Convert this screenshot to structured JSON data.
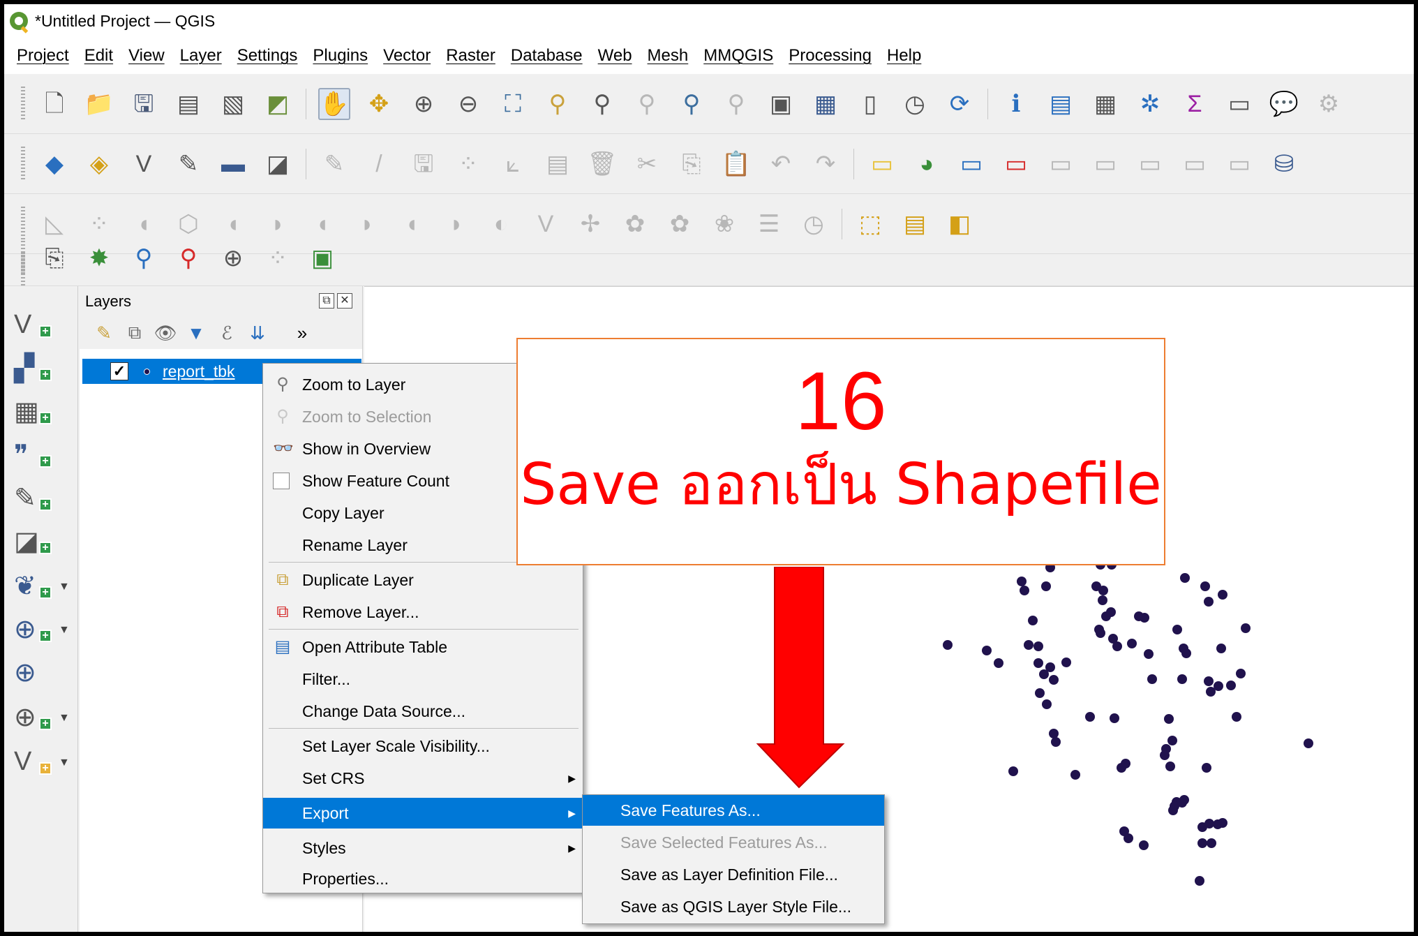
{
  "window": {
    "title": "*Untitled Project — QGIS"
  },
  "menubar": {
    "items": [
      "Project",
      "Edit",
      "View",
      "Layer",
      "Settings",
      "Plugins",
      "Vector",
      "Raster",
      "Database",
      "Web",
      "Mesh",
      "MMQGIS",
      "Processing",
      "Help"
    ]
  },
  "layers_panel": {
    "title": "Layers",
    "overflow_label": "»",
    "layer": {
      "name": "report_tbk",
      "checked": "✓"
    }
  },
  "context_menu": {
    "zoom_to_layer": "Zoom to Layer",
    "zoom_to_selection": "Zoom to Selection",
    "show_in_overview": "Show in Overview",
    "show_feature_count": "Show Feature Count",
    "copy_layer": "Copy Layer",
    "rename_layer": "Rename Layer",
    "duplicate_layer": "Duplicate Layer",
    "remove_layer": "Remove Layer...",
    "open_attribute_table": "Open Attribute Table",
    "filter": "Filter...",
    "change_data_source": "Change Data Source...",
    "set_layer_scale_visibility": "Set Layer Scale Visibility...",
    "set_crs": "Set CRS",
    "export": "Export",
    "styles": "Styles",
    "properties": "Properties..."
  },
  "export_submenu": {
    "save_features_as": "Save Features As...",
    "save_selected_features_as": "Save Selected Features As...",
    "save_as_layer_definition": "Save as Layer Definition File...",
    "save_as_qgis_layer_style": "Save as QGIS Layer Style File..."
  },
  "callout": {
    "step_number": "16",
    "text": "Save ออกเป็น Shapefile",
    "text_color": "#ff0000",
    "border_color": "#ed7d31"
  },
  "colors": {
    "highlight": "#0078d7",
    "point_fill": "#20124d",
    "arrow_fill": "#ff0000"
  }
}
